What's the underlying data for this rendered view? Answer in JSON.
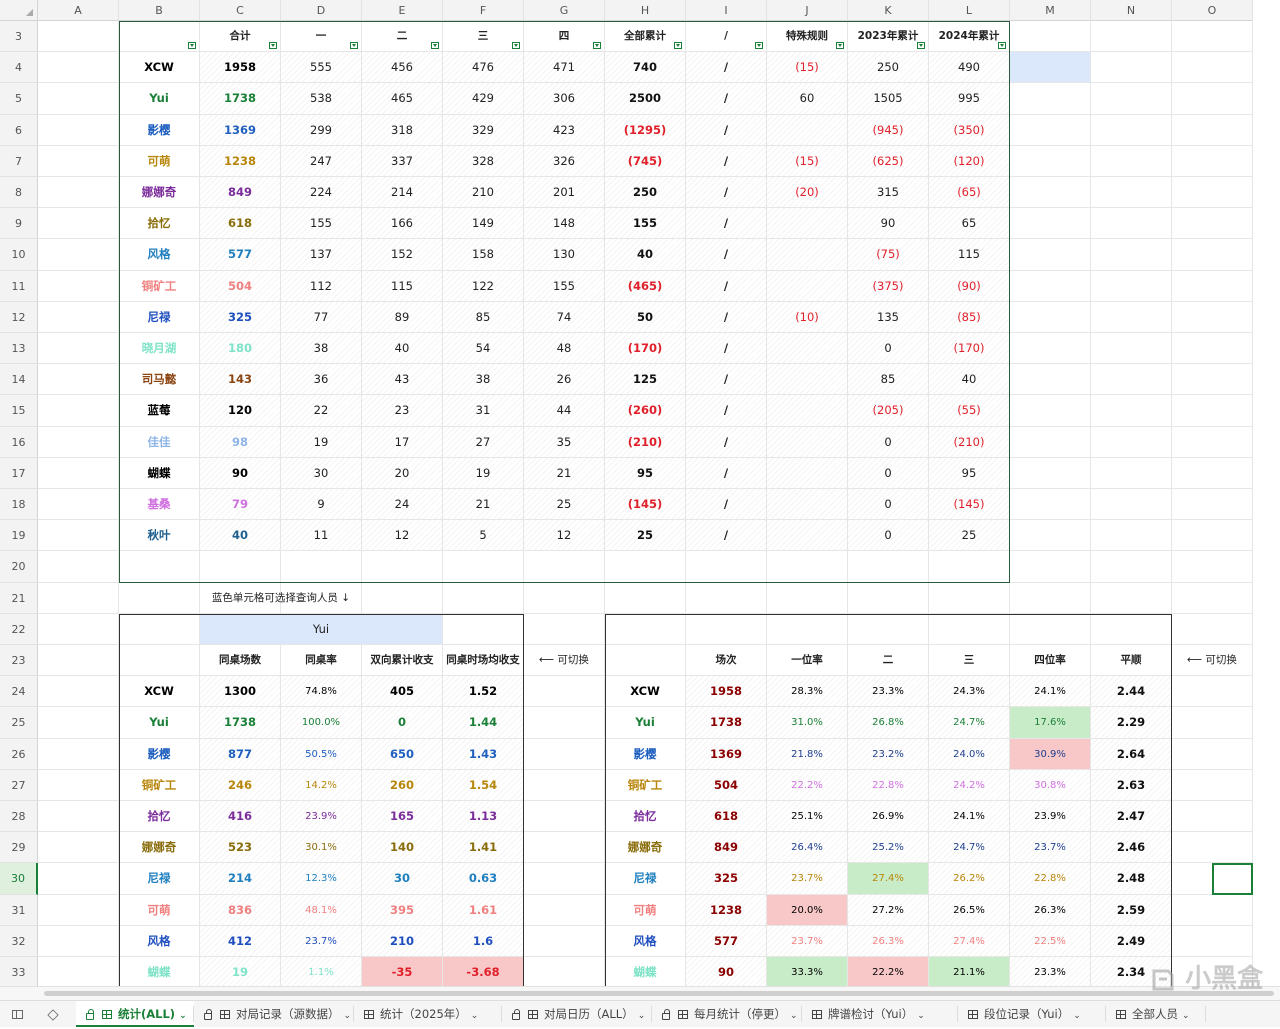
{
  "columns": [
    "A",
    "B",
    "C",
    "D",
    "E",
    "F",
    "G",
    "H",
    "I",
    "J",
    "K",
    "L",
    "M",
    "N",
    "O"
  ],
  "rows": [
    "3",
    "4",
    "5",
    "6",
    "7",
    "8",
    "9",
    "10",
    "11",
    "12",
    "13",
    "14",
    "15",
    "16",
    "17",
    "18",
    "19",
    "20",
    "21",
    "22",
    "23",
    "24",
    "25",
    "26",
    "27",
    "28",
    "29",
    "30",
    "31",
    "32",
    "33"
  ],
  "selected_row": "30",
  "top_table": {
    "headers": [
      "",
      "合计",
      "一",
      "二",
      "三",
      "四",
      "全部累计",
      "/",
      "特殊规则",
      "2023年累计",
      "2024年累计"
    ],
    "rows": [
      {
        "name": "XCW",
        "color": "#000000",
        "total": "1958",
        "p1": "555",
        "p2": "456",
        "p3": "476",
        "p4": "471",
        "cum": "740",
        "cum_neg": false,
        "slash": "/",
        "special": "(15)",
        "y2023": "250",
        "y2024": "490"
      },
      {
        "name": "Yui",
        "color": "#1a7f37",
        "total": "1738",
        "p1": "538",
        "p2": "465",
        "p3": "429",
        "p4": "306",
        "cum": "2500",
        "cum_neg": false,
        "slash": "/",
        "special": "60",
        "y2023": "1505",
        "y2024": "995"
      },
      {
        "name": "影樱",
        "color": "#1f5fbf",
        "total": "1369",
        "p1": "299",
        "p2": "318",
        "p3": "329",
        "p4": "423",
        "cum": "(1295)",
        "cum_neg": true,
        "slash": "/",
        "special": "",
        "y2023": "(945)",
        "y2024": "(350)"
      },
      {
        "name": "可萌",
        "color": "#b8860b",
        "total": "1238",
        "p1": "247",
        "p2": "337",
        "p3": "328",
        "p4": "326",
        "cum": "(745)",
        "cum_neg": true,
        "slash": "/",
        "special": "(15)",
        "y2023": "(625)",
        "y2024": "(120)"
      },
      {
        "name": "娜娜奇",
        "color": "#7b2d9b",
        "total": "849",
        "p1": "224",
        "p2": "214",
        "p3": "210",
        "p4": "201",
        "cum": "250",
        "cum_neg": false,
        "slash": "/",
        "special": "(20)",
        "y2023": "315",
        "y2024": "(65)"
      },
      {
        "name": "拾忆",
        "color": "#8a6d0b",
        "total": "618",
        "p1": "155",
        "p2": "166",
        "p3": "149",
        "p4": "148",
        "cum": "155",
        "cum_neg": false,
        "slash": "/",
        "special": "",
        "y2023": "90",
        "y2024": "65"
      },
      {
        "name": "风格",
        "color": "#1f7fbf",
        "total": "577",
        "p1": "137",
        "p2": "152",
        "p3": "158",
        "p4": "130",
        "cum": "40",
        "cum_neg": false,
        "slash": "/",
        "special": "",
        "y2023": "(75)",
        "y2024": "115"
      },
      {
        "name": "铜矿工",
        "color": "#f08080",
        "total": "504",
        "p1": "112",
        "p2": "115",
        "p3": "122",
        "p4": "155",
        "cum": "(465)",
        "cum_neg": true,
        "slash": "/",
        "special": "",
        "y2023": "(375)",
        "y2024": "(90)"
      },
      {
        "name": "尼禄",
        "color": "#1f4fbf",
        "total": "325",
        "p1": "77",
        "p2": "89",
        "p3": "85",
        "p4": "74",
        "cum": "50",
        "cum_neg": false,
        "slash": "/",
        "special": "(10)",
        "y2023": "135",
        "y2024": "(85)"
      },
      {
        "name": "晓月湖",
        "color": "#7fe3c8",
        "total": "180",
        "p1": "38",
        "p2": "40",
        "p3": "54",
        "p4": "48",
        "cum": "(170)",
        "cum_neg": true,
        "slash": "/",
        "special": "",
        "y2023": "0",
        "y2024": "(170)"
      },
      {
        "name": "司马懿",
        "color": "#8b4513",
        "total": "143",
        "p1": "36",
        "p2": "43",
        "p3": "38",
        "p4": "26",
        "cum": "125",
        "cum_neg": false,
        "slash": "/",
        "special": "",
        "y2023": "85",
        "y2024": "40"
      },
      {
        "name": "蓝莓",
        "color": "#000000",
        "total": "120",
        "p1": "22",
        "p2": "23",
        "p3": "31",
        "p4": "44",
        "cum": "(260)",
        "cum_neg": true,
        "slash": "/",
        "special": "",
        "y2023": "(205)",
        "y2024": "(55)"
      },
      {
        "name": "佳佳",
        "color": "#8fb4e8",
        "total": "98",
        "p1": "19",
        "p2": "17",
        "p3": "27",
        "p4": "35",
        "cum": "(210)",
        "cum_neg": true,
        "slash": "/",
        "special": "",
        "y2023": "0",
        "y2024": "(210)"
      },
      {
        "name": "蝴蝶",
        "color": "#000000",
        "total": "90",
        "p1": "30",
        "p2": "20",
        "p3": "19",
        "p4": "21",
        "cum": "95",
        "cum_neg": false,
        "slash": "/",
        "special": "",
        "y2023": "0",
        "y2024": "95"
      },
      {
        "name": "基桑",
        "color": "#d070e0",
        "total": "79",
        "p1": "9",
        "p2": "24",
        "p3": "21",
        "p4": "25",
        "cum": "(145)",
        "cum_neg": true,
        "slash": "/",
        "special": "",
        "y2023": "0",
        "y2024": "(145)"
      },
      {
        "name": "秋叶",
        "color": "#1f5f8f",
        "total": "40",
        "p1": "11",
        "p2": "12",
        "p3": "5",
        "p4": "12",
        "cum": "25",
        "cum_neg": false,
        "slash": "/",
        "special": "",
        "y2023": "0",
        "y2024": "25"
      }
    ]
  },
  "note": "蓝色单元格可选择查询人员 ↓",
  "left_table": {
    "selected_person": "Yui",
    "headers": [
      "同桌场数",
      "同桌率",
      "双向累计收支",
      "同桌时场均收支"
    ],
    "switch_label": "⟵ 可切换",
    "rows": [
      {
        "name": "XCW",
        "color": "#000000",
        "games": "1300",
        "rate": "74.8%",
        "net": "405",
        "avg": "1.52",
        "neg": false
      },
      {
        "name": "Yui",
        "color": "#1a7f37",
        "games": "1738",
        "rate": "100.0%",
        "net": "0",
        "avg": "1.44",
        "neg": false
      },
      {
        "name": "影樱",
        "color": "#1f5fbf",
        "games": "877",
        "rate": "50.5%",
        "net": "650",
        "avg": "1.43",
        "neg": false
      },
      {
        "name": "铜矿工",
        "color": "#b8860b",
        "games": "246",
        "rate": "14.2%",
        "net": "260",
        "avg": "1.54",
        "neg": false
      },
      {
        "name": "拾忆",
        "color": "#7b2d9b",
        "games": "416",
        "rate": "23.9%",
        "net": "165",
        "avg": "1.13",
        "neg": false
      },
      {
        "name": "娜娜奇",
        "color": "#8a6d0b",
        "games": "523",
        "rate": "30.1%",
        "net": "140",
        "avg": "1.41",
        "neg": false
      },
      {
        "name": "尼禄",
        "color": "#1f7fbf",
        "games": "214",
        "rate": "12.3%",
        "net": "30",
        "avg": "0.63",
        "neg": false
      },
      {
        "name": "可萌",
        "color": "#f08080",
        "games": "836",
        "rate": "48.1%",
        "net": "395",
        "avg": "1.61",
        "neg": false
      },
      {
        "name": "风格",
        "color": "#1f4fbf",
        "games": "412",
        "rate": "23.7%",
        "net": "210",
        "avg": "1.6",
        "neg": false
      },
      {
        "name": "蝴蝶",
        "color": "#7fe3c8",
        "games": "19",
        "rate": "1.1%",
        "net": "-35",
        "avg": "-3.68",
        "neg": true
      }
    ]
  },
  "right_table": {
    "headers": [
      "场次",
      "一位率",
      "二",
      "三",
      "四位率",
      "平顺"
    ],
    "switch_label": "⟵ 可切换",
    "rows": [
      {
        "name": "XCW",
        "color": "#000000",
        "games": "1958",
        "r1": "28.3%",
        "r2": "23.3%",
        "r3": "24.3%",
        "r4": "24.1%",
        "avg": "2.44",
        "tcolor": "#000000",
        "h1": "",
        "h2": "",
        "h3": "",
        "h4": ""
      },
      {
        "name": "Yui",
        "color": "#1a7f37",
        "games": "1738",
        "r1": "31.0%",
        "r2": "26.8%",
        "r3": "24.7%",
        "r4": "17.6%",
        "avg": "2.29",
        "tcolor": "#1a7f37",
        "h1": "",
        "h2": "",
        "h3": "",
        "h4": "#c8ecc8"
      },
      {
        "name": "影樱",
        "color": "#1f5fbf",
        "games": "1369",
        "r1": "21.8%",
        "r2": "23.2%",
        "r3": "24.0%",
        "r4": "30.9%",
        "avg": "2.64",
        "tcolor": "#1f3f8f",
        "h1": "",
        "h2": "",
        "h3": "",
        "h4": "#f8c8c8"
      },
      {
        "name": "铜矿工",
        "color": "#b8860b",
        "games": "504",
        "r1": "22.2%",
        "r2": "22.8%",
        "r3": "24.2%",
        "r4": "30.8%",
        "avg": "2.63",
        "tcolor": "#d070e0",
        "h1": "",
        "h2": "",
        "h3": "",
        "h4": ""
      },
      {
        "name": "拾忆",
        "color": "#7b2d9b",
        "games": "618",
        "r1": "25.1%",
        "r2": "26.9%",
        "r3": "24.1%",
        "r4": "23.9%",
        "avg": "2.47",
        "tcolor": "#000000",
        "h1": "",
        "h2": "",
        "h3": "",
        "h4": ""
      },
      {
        "name": "娜娜奇",
        "color": "#8a6d0b",
        "games": "849",
        "r1": "26.4%",
        "r2": "25.2%",
        "r3": "24.7%",
        "r4": "23.7%",
        "avg": "2.46",
        "tcolor": "#1f3f8f",
        "h1": "",
        "h2": "",
        "h3": "",
        "h4": ""
      },
      {
        "name": "尼禄",
        "color": "#1f7fbf",
        "games": "325",
        "r1": "23.7%",
        "r2": "27.4%",
        "r3": "26.2%",
        "r4": "22.8%",
        "avg": "2.48",
        "tcolor": "#b8860b",
        "h1": "",
        "h2": "#c8ecc8",
        "h3": "",
        "h4": ""
      },
      {
        "name": "可萌",
        "color": "#f08080",
        "games": "1238",
        "r1": "20.0%",
        "r2": "27.2%",
        "r3": "26.5%",
        "r4": "26.3%",
        "avg": "2.59",
        "tcolor": "#000000",
        "h1": "#f8c8c8",
        "h2": "",
        "h3": "",
        "h4": ""
      },
      {
        "name": "风格",
        "color": "#1f4fbf",
        "games": "577",
        "r1": "23.7%",
        "r2": "26.3%",
        "r3": "27.4%",
        "r4": "22.5%",
        "avg": "2.49",
        "tcolor": "#f08080",
        "h1": "",
        "h2": "",
        "h3": "",
        "h4": ""
      },
      {
        "name": "蝴蝶",
        "color": "#7fe3c8",
        "games": "90",
        "r1": "33.3%",
        "r2": "22.2%",
        "r3": "21.1%",
        "r4": "23.3%",
        "avg": "2.34",
        "tcolor": "#000000",
        "h1": "#c8ecc8",
        "h2": "#f8c8c8",
        "h3": "#c8ecc8",
        "h4": ""
      }
    ]
  },
  "sheet_tabs": [
    {
      "label": "统计(ALL)",
      "active": true,
      "locked": true
    },
    {
      "label": "对局记录（源数据）",
      "active": false,
      "locked": true
    },
    {
      "label": "统计（2025年）",
      "active": false,
      "locked": false
    },
    {
      "label": "对局日历（ALL）",
      "active": false,
      "locked": true
    },
    {
      "label": "每月统计（停更）",
      "active": false,
      "locked": true
    },
    {
      "label": "牌谱检讨（Yui）",
      "active": false,
      "locked": false
    },
    {
      "label": "段位记录（Yui）",
      "active": false,
      "locked": false
    },
    {
      "label": "全部人员",
      "active": false,
      "locked": false
    }
  ],
  "watermark": "小黑盒",
  "colors": {
    "accent": "#1a7f37",
    "negative": "#e0202a",
    "select_blue": "#dbe8fb"
  }
}
